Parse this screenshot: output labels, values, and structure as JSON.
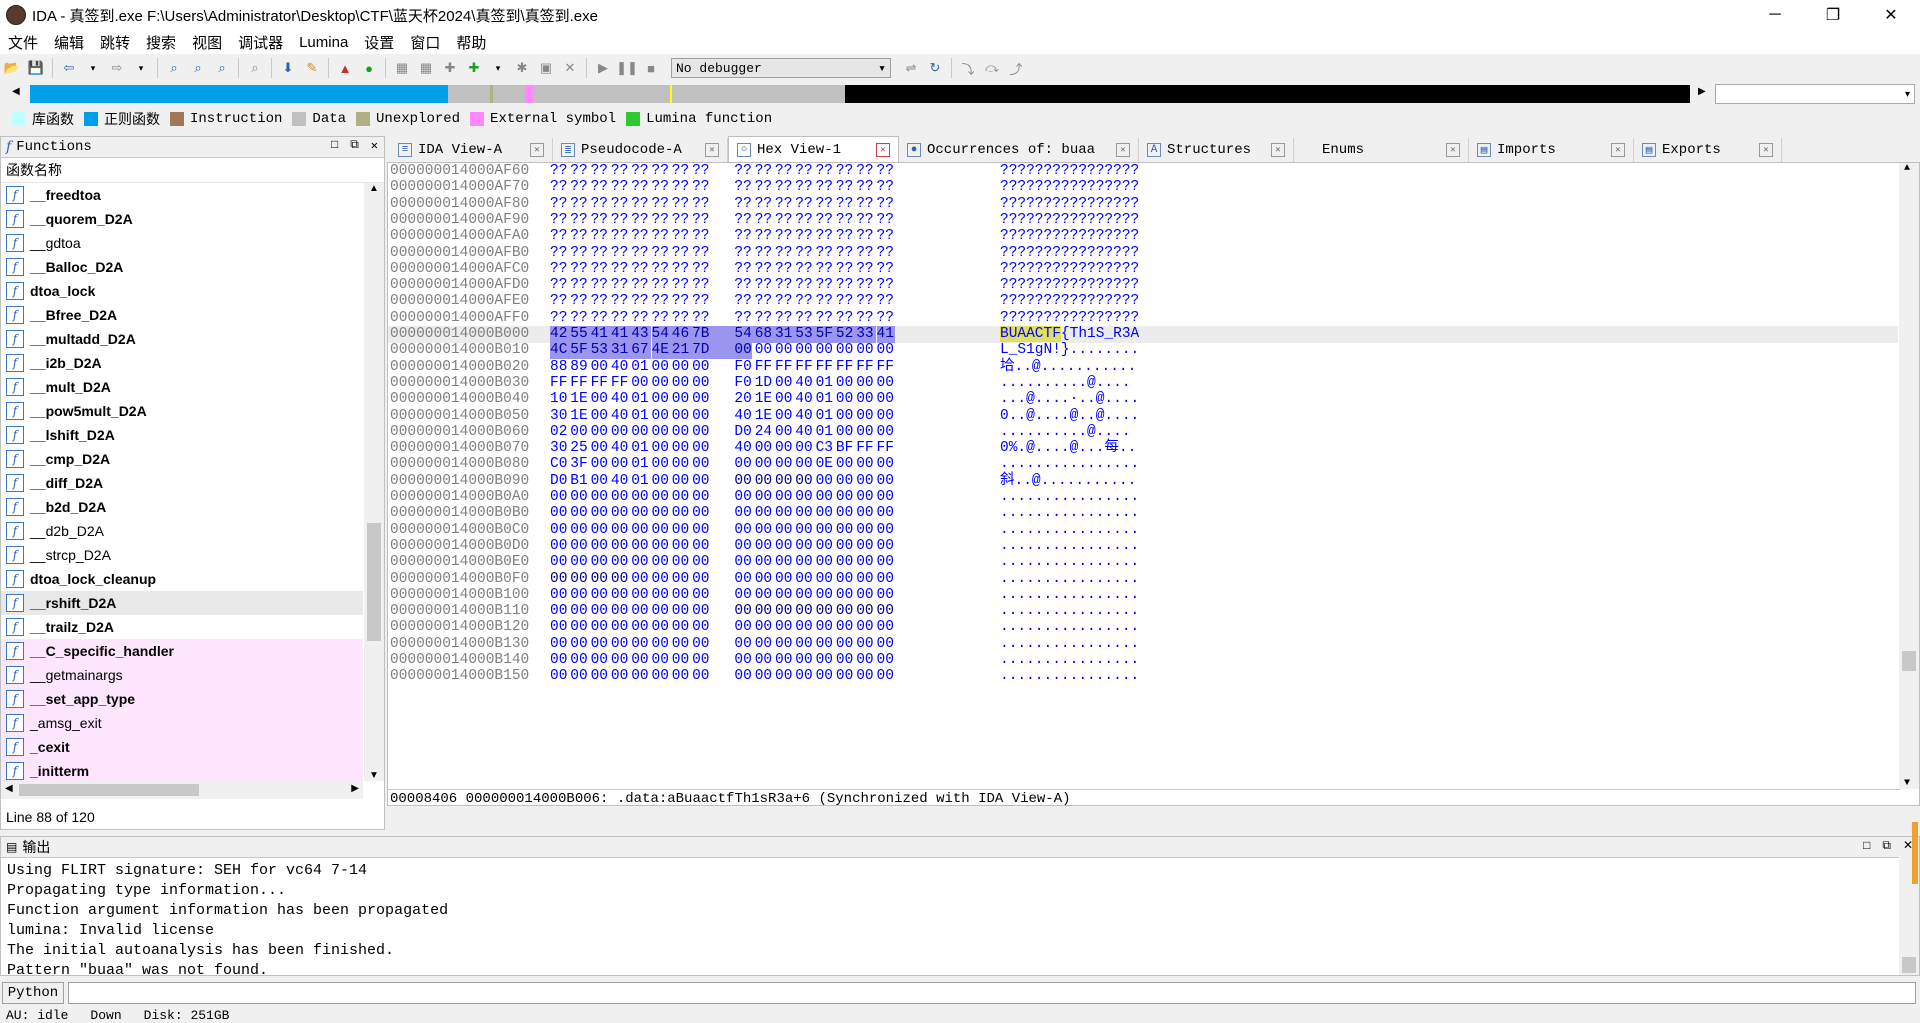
{
  "window": {
    "title": "IDA - 真签到.exe F:\\Users\\Administrator\\Desktop\\CTF\\蓝天杯2024\\真签到\\真签到.exe",
    "minimize": "─",
    "maximize": "❐",
    "close": "✕"
  },
  "menu": [
    "文件",
    "编辑",
    "跳转",
    "搜索",
    "视图",
    "调试器",
    "Lumina",
    "设置",
    "窗口",
    "帮助"
  ],
  "toolbar": {
    "debugger_select": "No debugger",
    "arrow": "▾"
  },
  "legend": [
    {
      "label": "库函数",
      "color": "#c0ffff"
    },
    {
      "label": "正则函数",
      "color": "#00a0e8"
    },
    {
      "label": "Instruction",
      "color": "#a07858"
    },
    {
      "label": "Data",
      "color": "#c0c0c0"
    },
    {
      "label": "Unexplored",
      "color": "#b0b080"
    },
    {
      "label": "External symbol",
      "color": "#ff88ff"
    },
    {
      "label": "Lumina function",
      "color": "#30c830"
    }
  ],
  "colors": {
    "navbar_code": "#00a0e8",
    "navbar_data": "#c0c0c0",
    "navbar_unexplored": "#000000",
    "selection": "#9a96f0",
    "highlight_search": "#e0e060",
    "library_row": "#ffe6ff"
  },
  "functions": {
    "title": "Functions",
    "column_header": "函数名称",
    "status": "Line 88 of 120",
    "items": [
      {
        "name": "__freedtoa",
        "bold": true,
        "lib": false
      },
      {
        "name": "__quorem_D2A",
        "bold": true,
        "lib": false
      },
      {
        "name": "__gdtoa",
        "bold": false,
        "lib": false
      },
      {
        "name": "__Balloc_D2A",
        "bold": true,
        "lib": false
      },
      {
        "name": "dtoa_lock",
        "bold": true,
        "lib": false
      },
      {
        "name": "__Bfree_D2A",
        "bold": true,
        "lib": false
      },
      {
        "name": "__multadd_D2A",
        "bold": true,
        "lib": false
      },
      {
        "name": "__i2b_D2A",
        "bold": true,
        "lib": false
      },
      {
        "name": "__mult_D2A",
        "bold": true,
        "lib": false
      },
      {
        "name": "__pow5mult_D2A",
        "bold": true,
        "lib": false
      },
      {
        "name": "__lshift_D2A",
        "bold": true,
        "lib": false
      },
      {
        "name": "__cmp_D2A",
        "bold": true,
        "lib": false
      },
      {
        "name": "__diff_D2A",
        "bold": true,
        "lib": false
      },
      {
        "name": "__b2d_D2A",
        "bold": true,
        "lib": false
      },
      {
        "name": "__d2b_D2A",
        "bold": false,
        "lib": false
      },
      {
        "name": "__strcp_D2A",
        "bold": false,
        "lib": false
      },
      {
        "name": "dtoa_lock_cleanup",
        "bold": true,
        "lib": false
      },
      {
        "name": "__rshift_D2A",
        "bold": true,
        "lib": false,
        "selected": true
      },
      {
        "name": "__trailz_D2A",
        "bold": true,
        "lib": false
      },
      {
        "name": "__C_specific_handler",
        "bold": true,
        "lib": true
      },
      {
        "name": "__getmainargs",
        "bold": false,
        "lib": true
      },
      {
        "name": "__set_app_type",
        "bold": true,
        "lib": true
      },
      {
        "name": "_amsg_exit",
        "bold": false,
        "lib": true
      },
      {
        "name": "_cexit",
        "bold": true,
        "lib": true
      },
      {
        "name": "_initterm",
        "bold": true,
        "lib": true
      }
    ]
  },
  "tabs": [
    {
      "label": "IDA View-A",
      "icon": "≡",
      "active": false
    },
    {
      "label": "Pseudocode-A",
      "icon": "≣",
      "active": false
    },
    {
      "label": "Hex View-1",
      "icon": "○",
      "active": true
    },
    {
      "label": "Occurrences of: buaa",
      "icon": "●",
      "active": false
    },
    {
      "label": "Structures",
      "icon": "A",
      "active": false
    },
    {
      "label": "Enums",
      "icon": "",
      "active": false
    },
    {
      "label": "Imports",
      "icon": "▤",
      "active": false
    },
    {
      "label": "Exports",
      "icon": "▤",
      "active": false
    }
  ],
  "hex": {
    "status": "00008406 000000014000B006: .data:aBuaactfTh1sR3a+6 (Synchronized with IDA View-A)",
    "rows": [
      {
        "addr": "000000014000AF60",
        "bytes": [
          "??",
          "??",
          "??",
          "??",
          "??",
          "??",
          "??",
          "??",
          "??",
          "??",
          "??",
          "??",
          "??",
          "??",
          "??",
          "??"
        ],
        "ascii": "????????????????"
      },
      {
        "addr": "000000014000AF70",
        "bytes": [
          "??",
          "??",
          "??",
          "??",
          "??",
          "??",
          "??",
          "??",
          "??",
          "??",
          "??",
          "??",
          "??",
          "??",
          "??",
          "??"
        ],
        "ascii": "????????????????"
      },
      {
        "addr": "000000014000AF80",
        "bytes": [
          "??",
          "??",
          "??",
          "??",
          "??",
          "??",
          "??",
          "??",
          "??",
          "??",
          "??",
          "??",
          "??",
          "??",
          "??",
          "??"
        ],
        "ascii": "????????????????"
      },
      {
        "addr": "000000014000AF90",
        "bytes": [
          "??",
          "??",
          "??",
          "??",
          "??",
          "??",
          "??",
          "??",
          "??",
          "??",
          "??",
          "??",
          "??",
          "??",
          "??",
          "??"
        ],
        "ascii": "????????????????"
      },
      {
        "addr": "000000014000AFA0",
        "bytes": [
          "??",
          "??",
          "??",
          "??",
          "??",
          "??",
          "??",
          "??",
          "??",
          "??",
          "??",
          "??",
          "??",
          "??",
          "??",
          "??"
        ],
        "ascii": "????????????????"
      },
      {
        "addr": "000000014000AFB0",
        "bytes": [
          "??",
          "??",
          "??",
          "??",
          "??",
          "??",
          "??",
          "??",
          "??",
          "??",
          "??",
          "??",
          "??",
          "??",
          "??",
          "??"
        ],
        "ascii": "????????????????"
      },
      {
        "addr": "000000014000AFC0",
        "bytes": [
          "??",
          "??",
          "??",
          "??",
          "??",
          "??",
          "??",
          "??",
          "??",
          "??",
          "??",
          "??",
          "??",
          "??",
          "??",
          "??"
        ],
        "ascii": "????????????????"
      },
      {
        "addr": "000000014000AFD0",
        "bytes": [
          "??",
          "??",
          "??",
          "??",
          "??",
          "??",
          "??",
          "??",
          "??",
          "??",
          "??",
          "??",
          "??",
          "??",
          "??",
          "??"
        ],
        "ascii": "????????????????"
      },
      {
        "addr": "000000014000AFE0",
        "bytes": [
          "??",
          "??",
          "??",
          "??",
          "??",
          "??",
          "??",
          "??",
          "??",
          "??",
          "??",
          "??",
          "??",
          "??",
          "??",
          "??"
        ],
        "ascii": "????????????????"
      },
      {
        "addr": "000000014000AFF0",
        "bytes": [
          "??",
          "??",
          "??",
          "??",
          "??",
          "??",
          "??",
          "??",
          "??",
          "??",
          "??",
          "??",
          "??",
          "??",
          "??",
          "??"
        ],
        "ascii": "????????????????"
      },
      {
        "addr": "000000014000B000",
        "bytes": [
          "42",
          "55",
          "41",
          "41",
          "43",
          "54",
          "46",
          "7B",
          "54",
          "68",
          "31",
          "53",
          "5F",
          "52",
          "33",
          "41"
        ],
        "ascii_hl": "BUAACTF",
        "ascii": "{Th1S_R3A",
        "hl": [
          0,
          16
        ],
        "current": true
      },
      {
        "addr": "000000014000B010",
        "bytes": [
          "4C",
          "5F",
          "53",
          "31",
          "67",
          "4E",
          "21",
          "7D",
          "00",
          "00",
          "00",
          "00",
          "00",
          "00",
          "00",
          "00"
        ],
        "ascii": "L_S1gN!}........",
        "hl": [
          0,
          9
        ]
      },
      {
        "addr": "000000014000B020",
        "bytes": [
          "88",
          "89",
          "00",
          "40",
          "01",
          "00",
          "00",
          "00",
          "F0",
          "FF",
          "FF",
          "FF",
          "FF",
          "FF",
          "FF",
          "FF"
        ],
        "ascii": "垥..@..........."
      },
      {
        "addr": "000000014000B030",
        "bytes": [
          "FF",
          "FF",
          "FF",
          "FF",
          "00",
          "00",
          "00",
          "00",
          "F0",
          "1D",
          "00",
          "40",
          "01",
          "00",
          "00",
          "00"
        ],
        "ascii": "..........@...."
      },
      {
        "addr": "000000014000B040",
        "bytes": [
          "10",
          "1E",
          "00",
          "40",
          "01",
          "00",
          "00",
          "00",
          "20",
          "1E",
          "00",
          "40",
          "01",
          "00",
          "00",
          "00"
        ],
        "ascii": "...@....·..@...."
      },
      {
        "addr": "000000014000B050",
        "bytes": [
          "30",
          "1E",
          "00",
          "40",
          "01",
          "00",
          "00",
          "00",
          "40",
          "1E",
          "00",
          "40",
          "01",
          "00",
          "00",
          "00"
        ],
        "ascii": "0..@....@..@...."
      },
      {
        "addr": "000000014000B060",
        "bytes": [
          "02",
          "00",
          "00",
          "00",
          "00",
          "00",
          "00",
          "00",
          "D0",
          "24",
          "00",
          "40",
          "01",
          "00",
          "00",
          "00"
        ],
        "ascii": "..........@...."
      },
      {
        "addr": "000000014000B070",
        "bytes": [
          "30",
          "25",
          "00",
          "40",
          "01",
          "00",
          "00",
          "00",
          "40",
          "00",
          "00",
          "00",
          "C3",
          "BF",
          "FF",
          "FF"
        ],
        "ascii": "0%.@....@...每.."
      },
      {
        "addr": "000000014000B080",
        "bytes": [
          "C0",
          "3F",
          "00",
          "00",
          "01",
          "00",
          "00",
          "00",
          "00",
          "00",
          "00",
          "00",
          "0E",
          "00",
          "00",
          "00"
        ],
        "ascii": "................"
      },
      {
        "addr": "000000014000B090",
        "bytes": [
          "D0",
          "B1",
          "00",
          "40",
          "01",
          "00",
          "00",
          "00",
          "00",
          "00",
          "00",
          "00",
          "00",
          "00",
          "00",
          "00"
        ],
        "ascii": "斜..@...........",
        "dark": [
          8,
          12
        ]
      },
      {
        "addr": "000000014000B0A0",
        "bytes": [
          "00",
          "00",
          "00",
          "00",
          "00",
          "00",
          "00",
          "00",
          "00",
          "00",
          "00",
          "00",
          "00",
          "00",
          "00",
          "00"
        ],
        "ascii": "................"
      },
      {
        "addr": "000000014000B0B0",
        "bytes": [
          "00",
          "00",
          "00",
          "00",
          "00",
          "00",
          "00",
          "00",
          "00",
          "00",
          "00",
          "00",
          "00",
          "00",
          "00",
          "00"
        ],
        "ascii": "................"
      },
      {
        "addr": "000000014000B0C0",
        "bytes": [
          "00",
          "00",
          "00",
          "00",
          "00",
          "00",
          "00",
          "00",
          "00",
          "00",
          "00",
          "00",
          "00",
          "00",
          "00",
          "00"
        ],
        "ascii": "................"
      },
      {
        "addr": "000000014000B0D0",
        "bytes": [
          "00",
          "00",
          "00",
          "00",
          "00",
          "00",
          "00",
          "00",
          "00",
          "00",
          "00",
          "00",
          "00",
          "00",
          "00",
          "00"
        ],
        "ascii": "................"
      },
      {
        "addr": "000000014000B0E0",
        "bytes": [
          "00",
          "00",
          "00",
          "00",
          "00",
          "00",
          "00",
          "00",
          "00",
          "00",
          "00",
          "00",
          "00",
          "00",
          "00",
          "00"
        ],
        "ascii": "................"
      },
      {
        "addr": "000000014000B0F0",
        "bytes": [
          "00",
          "00",
          "00",
          "00",
          "00",
          "00",
          "00",
          "00",
          "00",
          "00",
          "00",
          "00",
          "00",
          "00",
          "00",
          "00"
        ],
        "ascii": "................",
        "dark": [
          0,
          4
        ]
      },
      {
        "addr": "000000014000B100",
        "bytes": [
          "00",
          "00",
          "00",
          "00",
          "00",
          "00",
          "00",
          "00",
          "00",
          "00",
          "00",
          "00",
          "00",
          "00",
          "00",
          "00"
        ],
        "ascii": "................"
      },
      {
        "addr": "000000014000B110",
        "bytes": [
          "00",
          "00",
          "00",
          "00",
          "00",
          "00",
          "00",
          "00",
          "00",
          "00",
          "00",
          "00",
          "00",
          "00",
          "00",
          "00"
        ],
        "ascii": "................",
        "dark": [
          8,
          16
        ]
      },
      {
        "addr": "000000014000B120",
        "bytes": [
          "00",
          "00",
          "00",
          "00",
          "00",
          "00",
          "00",
          "00",
          "00",
          "00",
          "00",
          "00",
          "00",
          "00",
          "00",
          "00"
        ],
        "ascii": "................"
      },
      {
        "addr": "000000014000B130",
        "bytes": [
          "00",
          "00",
          "00",
          "00",
          "00",
          "00",
          "00",
          "00",
          "00",
          "00",
          "00",
          "00",
          "00",
          "00",
          "00",
          "00"
        ],
        "ascii": "................"
      },
      {
        "addr": "000000014000B140",
        "bytes": [
          "00",
          "00",
          "00",
          "00",
          "00",
          "00",
          "00",
          "00",
          "00",
          "00",
          "00",
          "00",
          "00",
          "00",
          "00",
          "00"
        ],
        "ascii": "................"
      },
      {
        "addr": "000000014000B150",
        "bytes": [
          "00",
          "00",
          "00",
          "00",
          "00",
          "00",
          "00",
          "00",
          "00",
          "00",
          "00",
          "00",
          "00",
          "00",
          "00",
          "00"
        ],
        "ascii": "................"
      }
    ]
  },
  "output": {
    "title": "输出",
    "lines": [
      "Using FLIRT signature: SEH for vc64 7-14",
      "Propagating type information...",
      "Function argument information has been propagated",
      "lumina: Invalid license",
      "The initial autoanalysis has been finished.",
      "Pattern \"buaa\" was not found."
    ]
  },
  "python": {
    "button": "Python"
  },
  "status": {
    "au": "AU:  idle",
    "dir": "Down",
    "disk": "Disk: 251GB"
  }
}
